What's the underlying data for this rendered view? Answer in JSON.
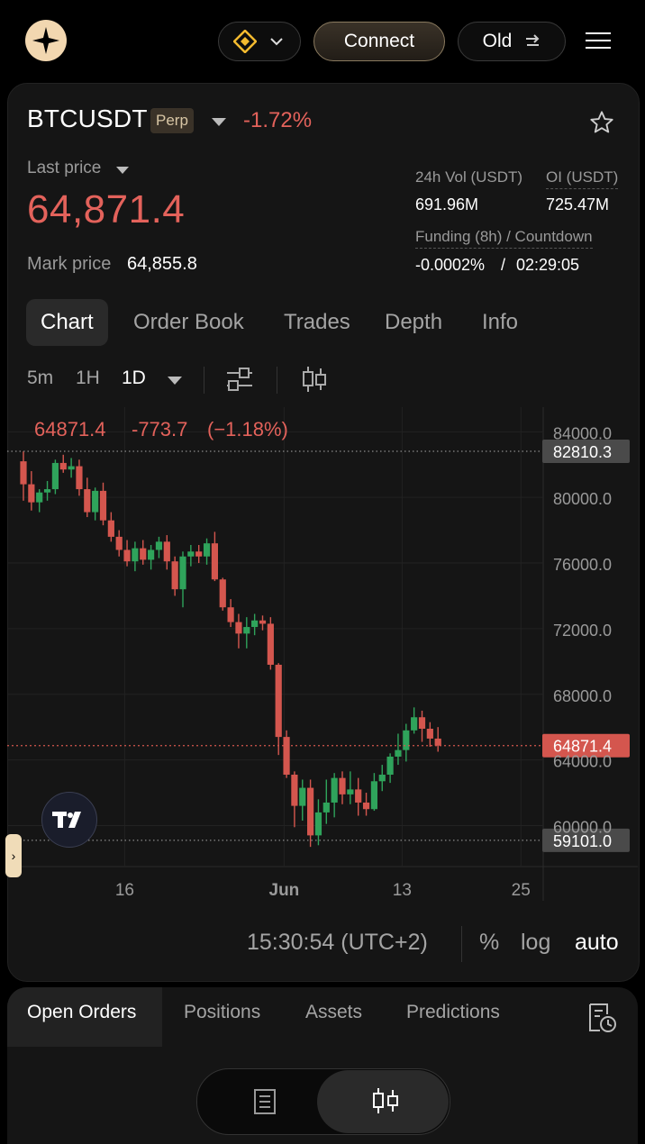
{
  "header": {
    "connect_label": "Connect",
    "old_label": "Old",
    "old_icon": "swap-arrows-icon",
    "network_icon": "bnb-chain-icon",
    "menu_icon": "hamburger-menu-icon"
  },
  "ticker": {
    "symbol": "BTCUSDT",
    "badge": "Perp",
    "change": "-1.72%",
    "last_price_label": "Last price",
    "last_price": "64,871.4",
    "mark_price_label": "Mark price",
    "mark_price": "64,855.8",
    "vol_label": "24h Vol (USDT)",
    "vol_value": "691.96M",
    "oi_label": "OI (USDT)",
    "oi_value": "725.47M",
    "funding_label": "Funding (8h) / Countdown",
    "funding_value": "-0.0002%",
    "funding_sep": "/",
    "countdown": "02:29:05"
  },
  "tabs": [
    "Chart",
    "Order Book",
    "Trades",
    "Depth",
    "Info"
  ],
  "timeframes": [
    "5m",
    "1H",
    "1D"
  ],
  "chart": {
    "header_price": "64871.4",
    "header_change": "-773.7",
    "header_pct": "(−1.18%)",
    "time_display": "15:30:54 (UTC+2)",
    "opt_pct": "%",
    "opt_log": "log",
    "opt_auto": "auto"
  },
  "chart_data": {
    "type": "candlestick",
    "ylim": [
      57500,
      85500
    ],
    "y_ticks": [
      "84000.0",
      "80000.0",
      "76000.0",
      "72000.0",
      "68000.0",
      "64000.0",
      "60000.0"
    ],
    "x_ticks": [
      "16",
      "Jun",
      "13",
      "25"
    ],
    "price_tags": [
      {
        "label": "82810.3",
        "value": 82810.3,
        "style": "grey"
      },
      {
        "label": "64871.4",
        "value": 64871.4,
        "style": "red"
      },
      {
        "label": "59101.0",
        "value": 59101.0,
        "style": "grey"
      }
    ],
    "candles": [
      [
        82200,
        82800,
        79800,
        80800
      ],
      [
        80800,
        81600,
        79200,
        79700
      ],
      [
        79700,
        80500,
        79100,
        80300
      ],
      [
        80300,
        81000,
        79800,
        80500
      ],
      [
        80500,
        82300,
        80200,
        82100
      ],
      [
        82100,
        82600,
        81500,
        81700
      ],
      [
        81700,
        82400,
        81200,
        81900
      ],
      [
        81900,
        82300,
        80100,
        80500
      ],
      [
        80500,
        81200,
        78800,
        79100
      ],
      [
        79100,
        80600,
        78600,
        80400
      ],
      [
        80400,
        80900,
        78300,
        78600
      ],
      [
        78600,
        79100,
        77300,
        77600
      ],
      [
        77600,
        78000,
        76400,
        76800
      ],
      [
        76800,
        77400,
        75800,
        76100
      ],
      [
        76100,
        77300,
        75500,
        76900
      ],
      [
        76900,
        77400,
        75900,
        76200
      ],
      [
        76200,
        77100,
        75600,
        76800
      ],
      [
        76800,
        77600,
        76300,
        77300
      ],
      [
        77300,
        77700,
        75600,
        76100
      ],
      [
        76100,
        76400,
        74000,
        74400
      ],
      [
        74400,
        76700,
        73300,
        76400
      ],
      [
        76400,
        77100,
        75800,
        76700
      ],
      [
        76700,
        77100,
        76000,
        76400
      ],
      [
        76400,
        77500,
        75900,
        77200
      ],
      [
        77200,
        77900,
        74900,
        75000
      ],
      [
        75000,
        75100,
        73100,
        73300
      ],
      [
        73300,
        73800,
        72100,
        72400
      ],
      [
        72400,
        72900,
        70800,
        71700
      ],
      [
        71700,
        72700,
        70800,
        72100
      ],
      [
        72100,
        72900,
        71600,
        72500
      ],
      [
        72500,
        72800,
        71900,
        72300
      ],
      [
        72300,
        72700,
        69500,
        69800
      ],
      [
        69800,
        69900,
        64300,
        65400
      ],
      [
        65400,
        65800,
        62900,
        63100
      ],
      [
        63100,
        63300,
        59900,
        61200
      ],
      [
        61200,
        62800,
        60300,
        62300
      ],
      [
        62300,
        62800,
        58700,
        59400
      ],
      [
        59400,
        61600,
        58800,
        60800
      ],
      [
        60800,
        62800,
        60100,
        61400
      ],
      [
        61400,
        63200,
        60500,
        62900
      ],
      [
        62900,
        63300,
        61300,
        61900
      ],
      [
        61900,
        63300,
        61300,
        62200
      ],
      [
        62200,
        62900,
        60600,
        61400
      ],
      [
        61400,
        62000,
        60600,
        61000
      ],
      [
        61000,
        63200,
        60900,
        62700
      ],
      [
        62700,
        63700,
        62100,
        63100
      ],
      [
        63100,
        64400,
        62600,
        64200
      ],
      [
        64200,
        65600,
        63700,
        64600
      ],
      [
        64600,
        66200,
        63900,
        65800
      ],
      [
        65800,
        67200,
        65600,
        66600
      ],
      [
        66600,
        67000,
        65100,
        65900
      ],
      [
        65900,
        66300,
        64800,
        65300
      ],
      [
        65300,
        66000,
        64500,
        64871.4
      ]
    ]
  }
}
